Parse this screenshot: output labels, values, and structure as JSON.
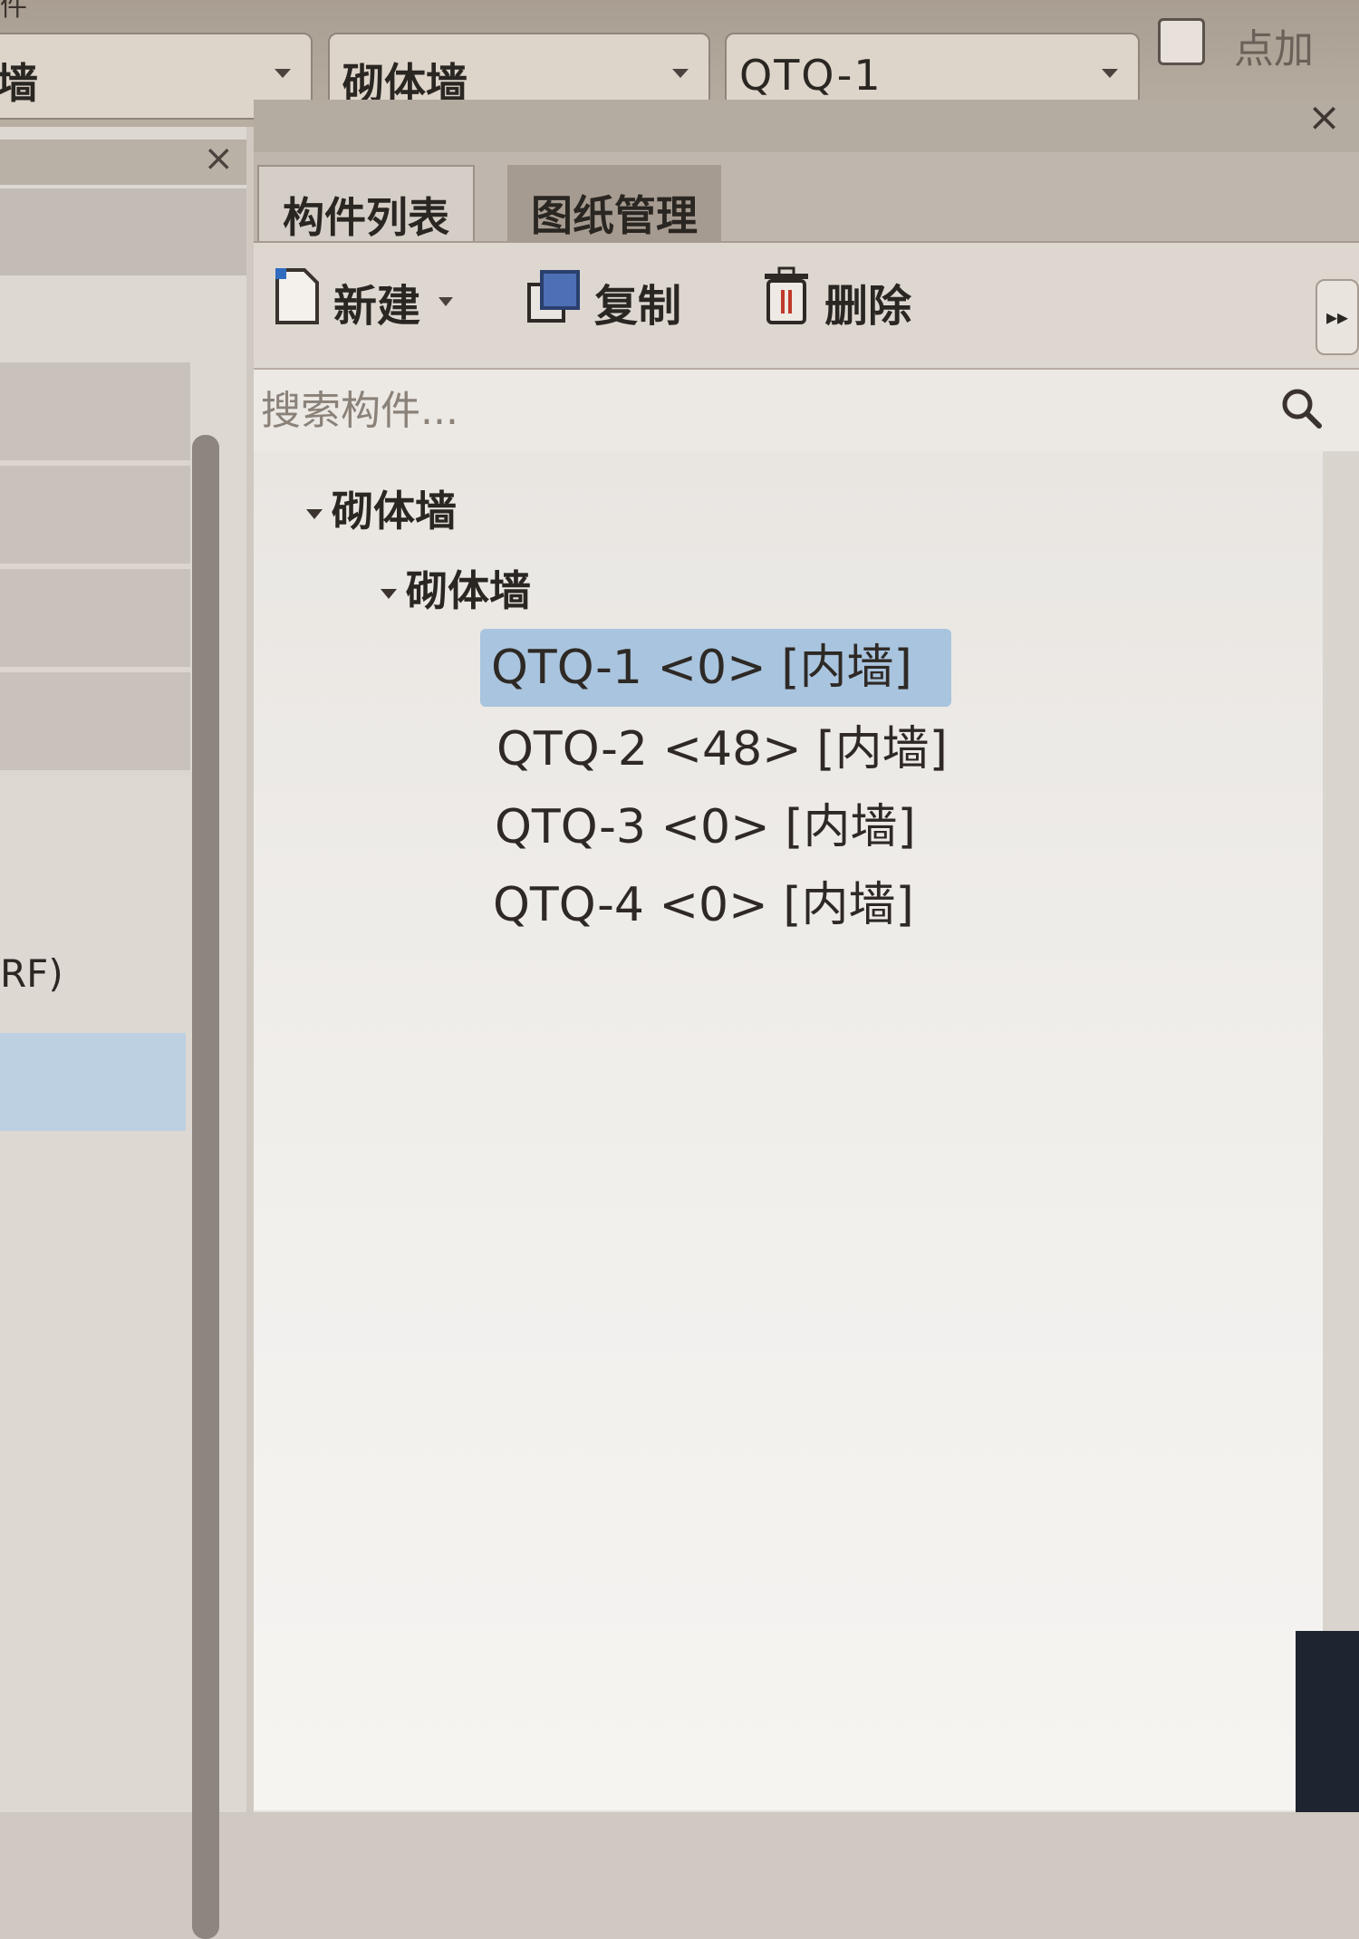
{
  "topbar": {
    "title_fragment": "件",
    "dropdown1": {
      "value": "墙"
    },
    "dropdown2": {
      "value": "砌体墙"
    },
    "dropdown3": {
      "value": "QTQ-1"
    },
    "checkbox_label": "点加"
  },
  "left_panel": {
    "close_label": "×",
    "text_fragment": "RF)"
  },
  "right_panel": {
    "close_label": "×",
    "tabs": [
      {
        "label": "构件列表"
      },
      {
        "label": "图纸管理"
      }
    ],
    "toolbar": {
      "new_label": "新建",
      "copy_label": "复制",
      "delete_label": "删除",
      "more_label": "▸▸"
    },
    "search": {
      "placeholder": "搜索构件..."
    },
    "tree": {
      "category": "砌体墙",
      "subcategory": "砌体墙",
      "items": [
        {
          "label": "QTQ-1 <0> [内墙]",
          "selected": true
        },
        {
          "label": "QTQ-2 <48> [内墙]",
          "selected": false
        },
        {
          "label": "QTQ-3 <0> [内墙]",
          "selected": false
        },
        {
          "label": "QTQ-4 <0> [内墙]",
          "selected": false
        }
      ]
    }
  },
  "colors": {
    "selection": "#a9c4de",
    "toolbar_bg": "#ddd7d0",
    "panel_bg": "#e6e2dd"
  }
}
